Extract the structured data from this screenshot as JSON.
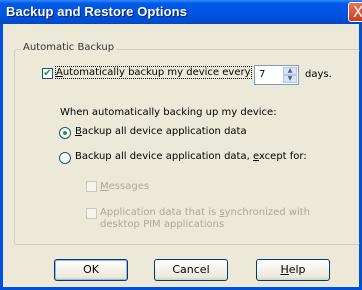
{
  "window": {
    "title": "Backup and Restore Options",
    "close_glyph": "X"
  },
  "group": {
    "label": "Automatic Backup"
  },
  "auto_backup": {
    "checked": true,
    "label_pre": "",
    "label_u": "A",
    "label_post": "utomatically backup my device every",
    "interval_value": "7",
    "unit": "days."
  },
  "when_label": "When automatically backing up my device:",
  "options": [
    {
      "pre": "",
      "u": "B",
      "post": "ackup all device application data",
      "selected": true
    },
    {
      "pre": "Backup all device application data, ",
      "u": "e",
      "post": "xcept for:",
      "selected": false
    }
  ],
  "exceptions": [
    {
      "pre": "",
      "u": "M",
      "post": "essages"
    },
    {
      "line1_pre": "Application data that is ",
      "line1_u": "s",
      "line1_post": "ynchronized with",
      "line2": "desktop PIM applications"
    }
  ],
  "buttons": {
    "ok": "OK",
    "cancel": "Cancel",
    "help_u": "H",
    "help_post": "elp"
  },
  "colors": {
    "titlebar": "#0054e3",
    "dialog": "#ece9d8",
    "check": "#21a121",
    "disabled_text": "#aca899"
  }
}
